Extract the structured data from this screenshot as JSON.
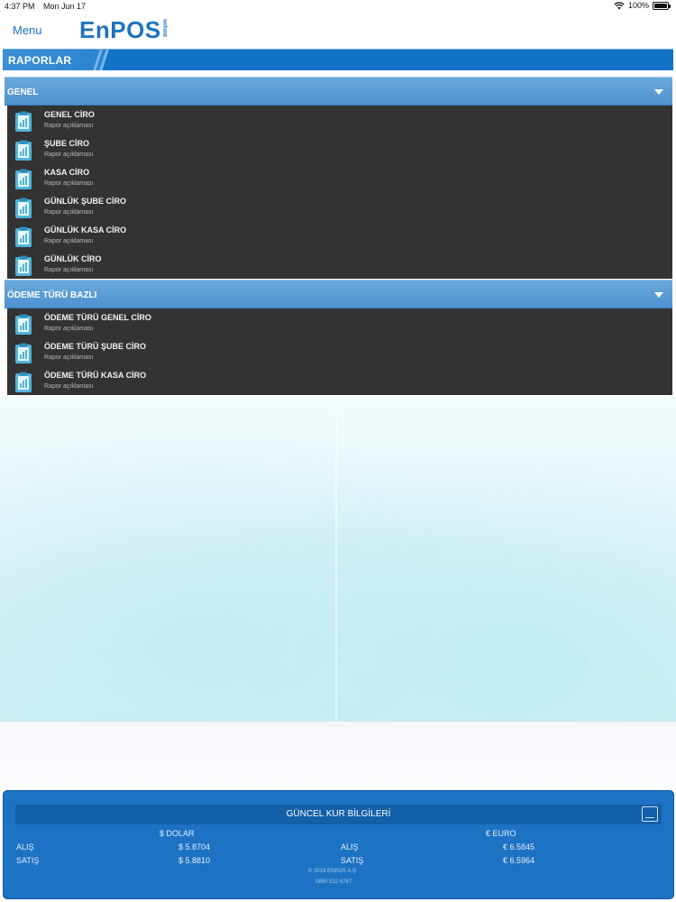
{
  "status_bar": {
    "time": "4:37 PM",
    "date": "Mon Jun 17",
    "battery": "100%"
  },
  "nav": {
    "menu_label": "Menu",
    "logo_text": "EnPOS",
    "logo_tag": "Bilişim"
  },
  "page": {
    "title": "RAPORLAR"
  },
  "sections": [
    {
      "label": "GENEL",
      "items": [
        {
          "title": "GENEL CİRO",
          "desc": "Rapor açıklaması"
        },
        {
          "title": "ŞUBE CİRO",
          "desc": "Rapor açıklaması"
        },
        {
          "title": "KASA CİRO",
          "desc": "Rapor açıklaması"
        },
        {
          "title": "GÜNLÜK ŞUBE CİRO",
          "desc": "Rapor açıklaması"
        },
        {
          "title": "GÜNLÜK KASA CİRO",
          "desc": "Rapor açıklaması"
        },
        {
          "title": "GÜNLÜK CİRO",
          "desc": "Rapor açıklaması"
        }
      ]
    },
    {
      "label": "ÖDEME TÜRÜ BAZLI",
      "items": [
        {
          "title": "ÖDEME TÜRÜ GENEL CİRO",
          "desc": "Rapor açıklaması"
        },
        {
          "title": "ÖDEME TÜRÜ ŞUBE CİRO",
          "desc": "Rapor açıklaması"
        },
        {
          "title": "ÖDEME TÜRÜ KASA CİRO",
          "desc": "Rapor açıklaması"
        }
      ]
    }
  ],
  "footer": {
    "title": "GÜNCEL KUR BİLGİLERİ",
    "dollar": {
      "header": "$ DOLAR",
      "buy_label": "ALIŞ",
      "buy": "$ 5.8704",
      "sell_label": "SATIŞ",
      "sell": "$ 5.8810"
    },
    "euro": {
      "header": "€ EURO",
      "buy_label": "ALIŞ",
      "buy": "€ 6.5845",
      "sell_label": "SATIŞ",
      "sell": "€ 6.5964"
    },
    "copyright": "© 2019 ENPOS A.Ş",
    "phone": "0850 532 6767"
  },
  "colors": {
    "brand": "#1e73be",
    "section_header": "#5a9bd4",
    "list_bg": "#333333",
    "icon": "#4fb3d9"
  }
}
